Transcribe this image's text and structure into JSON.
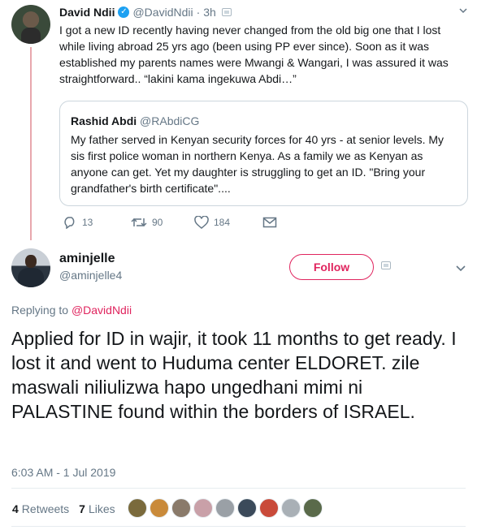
{
  "parent_tweet": {
    "name": "David Ndii",
    "handle": "@DavidNdii",
    "separator": "·",
    "time": "3h",
    "text": "I got a new ID recently having never changed from the old big one that I lost while living abroad 25 yrs ago (been using PP ever since). Soon as it was established my parents names were Mwangi & Wangari, I was assured it was straightforward.. “lakini kama ingekuwa Abdi…”",
    "quote": {
      "name": "Rashid Abdi",
      "handle": "@RAbdiCG",
      "text": "My father served in Kenyan security forces for 40 yrs - at senior levels. My sis first police woman in northern Kenya. As a family we as Kenyan as anyone can get. Yet my daughter is struggling to get an ID. \"Bring your grandfather's birth certificate\"...."
    },
    "actions": {
      "replies": "13",
      "retweets": "90",
      "likes": "184"
    }
  },
  "main_tweet": {
    "name": "aminjelle",
    "handle": "@aminjelle4",
    "follow_label": "Follow",
    "replying_prefix": "Replying to",
    "replying_to": "@DavidNdii",
    "text": "Applied for ID in wajir, it took 11 months to get ready. I lost it and went to Huduma center ELDORET. zile maswali niliulizwa hapo ungedhani mimi ni PALASTINE found within the borders of ISRAEL.",
    "timestamp": "6:03 AM - 1 Jul 2019",
    "retweets_count": "4",
    "retweets_label": "Retweets",
    "likes_count": "7",
    "likes_label": "Likes"
  },
  "colors": {
    "accent": "#e0245e",
    "muted": "#657786",
    "verified": "#1da1f2",
    "thread_line": "#e8a7ad"
  },
  "liker_avatars": [
    {
      "color": "#7a6a3c"
    },
    {
      "color": "#c98a3a"
    },
    {
      "color": "#8a7a6a"
    },
    {
      "color": "#c9a0a8"
    },
    {
      "color": "#9aa0a6"
    },
    {
      "color": "#3b4a5a"
    },
    {
      "color": "#c94a3a"
    },
    {
      "color": "#a9b0b6"
    },
    {
      "color": "#5a6a4a"
    }
  ]
}
